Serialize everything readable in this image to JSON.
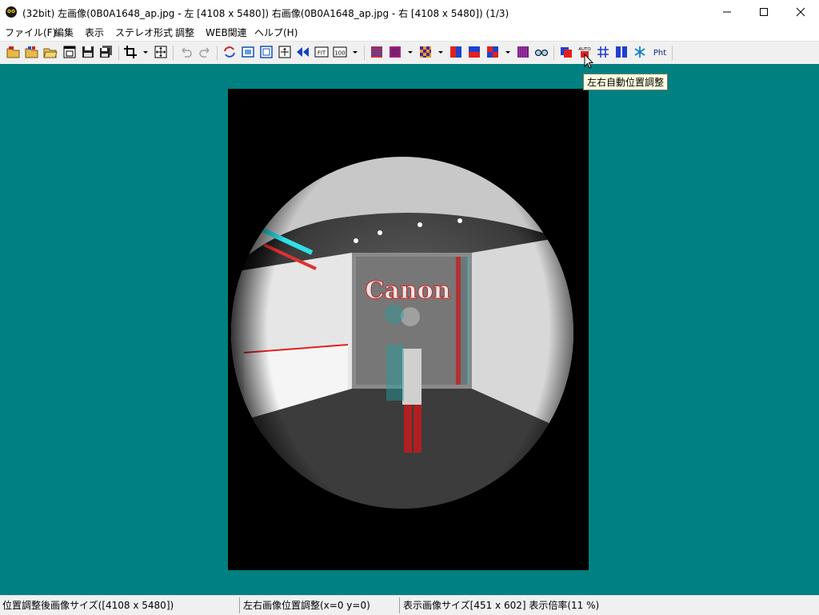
{
  "window": {
    "title": "(32bit) 左画像(0B0A1648_ap.jpg - 左 [4108 x 5480]) 右画像(0B0A1648_ap.jpg - 右 [4108 x 5480]) (1/3)"
  },
  "menu": {
    "items": [
      "ファイル(F)",
      "編集",
      "表示",
      "ステレオ形式",
      "調整",
      "WEB関連",
      "ヘルプ(H)"
    ]
  },
  "toolbar": {
    "auto_label": "AUTO",
    "fit_label": "FIT",
    "zoom100_label": "100",
    "pht_label": "Pht"
  },
  "tooltip": {
    "text": "左右自動位置調整"
  },
  "photo": {
    "sign_text": "Canon"
  },
  "status": {
    "pane1": "位置調整後画像サイズ([4108 x 5480])",
    "pane2": "左右画像位置調整(x=0 y=0)",
    "pane3": "表示画像サイズ[451 x 602]  表示倍率(11 %)"
  }
}
